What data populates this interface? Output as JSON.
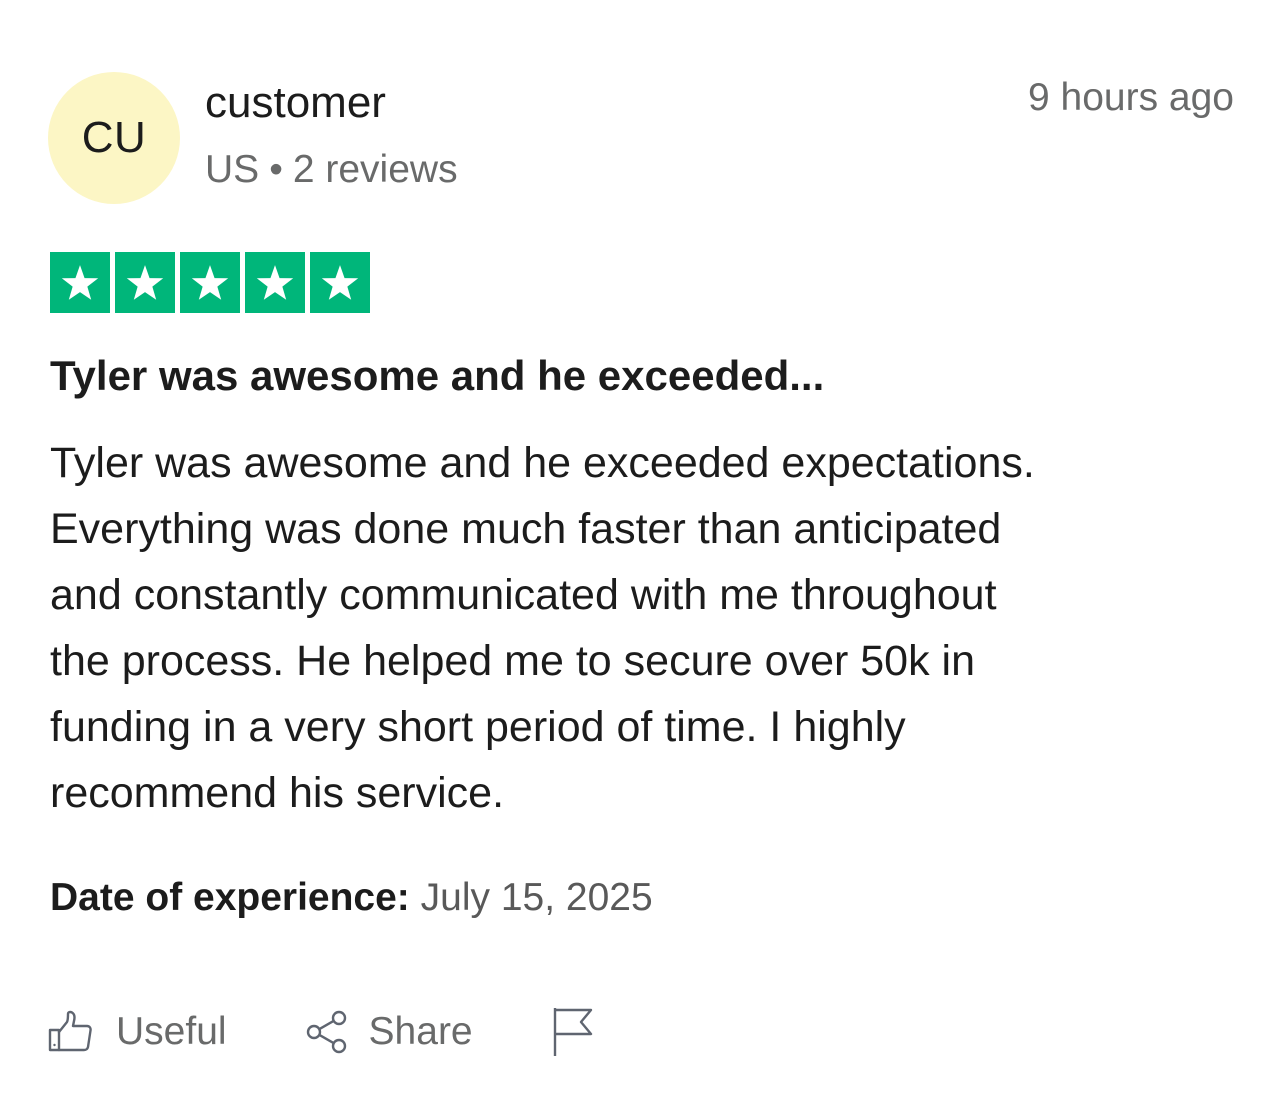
{
  "reviewer": {
    "initials": "CU",
    "name": "customer",
    "country": "US",
    "separator": "•",
    "reviews_count": "2 reviews",
    "avatar_color": "#fcf6c5"
  },
  "time_ago": "9 hours ago",
  "rating": {
    "value": 5,
    "max": 5,
    "color": "#00b67a"
  },
  "review": {
    "title": "Tyler was awesome and he exceeded...",
    "body_lines": [
      "Tyler was awesome and he exceeded expectations.",
      "Everything was done much faster than anticipated",
      "and constantly communicated with me throughout",
      "the process. He helped me to secure over 50k in",
      "funding in a very short period of time. I highly",
      "recommend his service."
    ]
  },
  "experience": {
    "label": "Date of experience:",
    "date": "July 15, 2025"
  },
  "actions": {
    "useful_label": "Useful",
    "useful_icon": "thumbs-up-icon",
    "share_label": "Share",
    "share_icon": "share-icon",
    "report_icon": "flag-icon"
  }
}
